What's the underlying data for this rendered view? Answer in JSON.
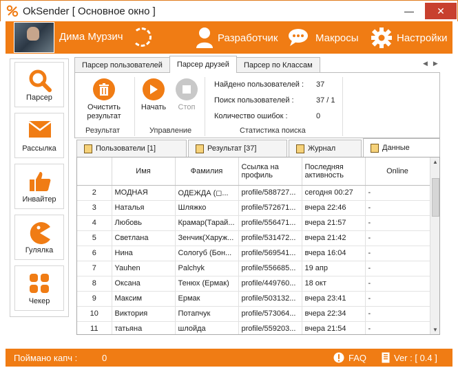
{
  "window": {
    "title": "OkSender [ Основное окно ]",
    "minimize": "—",
    "close": "✕"
  },
  "header": {
    "user_name": "Дима Мурзич",
    "developer_label": "Разработчик",
    "macros_label": "Макросы",
    "settings_label": "Настройки"
  },
  "sidebar": {
    "items": [
      {
        "label": "Парсер",
        "icon": "search-icon"
      },
      {
        "label": "Рассылка",
        "icon": "envelope-icon"
      },
      {
        "label": "Инвайтер",
        "icon": "thumbs-up-icon"
      },
      {
        "label": "Гулялка",
        "icon": "pacman-icon"
      },
      {
        "label": "Чекер",
        "icon": "grid-icon"
      }
    ]
  },
  "top_tabs": [
    "Парсер пользователей",
    "Парсер друзей",
    "Парсер по Классам"
  ],
  "toolbar": {
    "clear_label": "Очистить результат",
    "start_label": "Начать",
    "stop_label": "Стоп",
    "group_result": "Результат",
    "group_control": "Управление",
    "group_stats": "Статистика поиска",
    "stats": [
      {
        "label": "Найдено пользователей :",
        "value": "37"
      },
      {
        "label": "Поиск пользователей :",
        "value": "37 / 1"
      },
      {
        "label": "Количество ошибок :",
        "value": "0"
      }
    ]
  },
  "sub_tabs": [
    "Пользователи [1]",
    "Результат [37]",
    "Журнал",
    "Данные"
  ],
  "table": {
    "columns": [
      "",
      "Имя",
      "Фамилия",
      "Ссылка на профиль",
      "Последняя активность",
      "Online"
    ],
    "rows": [
      [
        "2",
        "МОДНАЯ",
        "ОДЕЖДА (◻...",
        "profile/588727...",
        "сегодня 00:27",
        "-"
      ],
      [
        "3",
        "Наталья",
        "Шляжко",
        "profile/572671...",
        "вчера 22:46",
        "-"
      ],
      [
        "4",
        "Любовь",
        "Крамар(Тарай...",
        "profile/556471...",
        "вчера 21:57",
        "-"
      ],
      [
        "5",
        "Светлана",
        "Зенчик(Харуж...",
        "profile/531472...",
        "вчера 21:42",
        "-"
      ],
      [
        "6",
        "Нина",
        "Сологуб (Бон...",
        "profile/569541...",
        "вчера 16:04",
        "-"
      ],
      [
        "7",
        "Yauhen",
        "Palchyk",
        "profile/556685...",
        "19 апр",
        "-"
      ],
      [
        "8",
        "Оксана",
        "Тенюх (Ермак)",
        "profile/449760...",
        "18 окт",
        "-"
      ],
      [
        "9",
        "Максим",
        "Ермак",
        "profile/503132...",
        "вчера 23:41",
        "-"
      ],
      [
        "10",
        "Виктория",
        "Потапчук",
        "profile/573064...",
        "вчера 22:34",
        "-"
      ],
      [
        "11",
        "татьяна",
        "шлойда",
        "profile/559203...",
        "вчера 21:54",
        "-"
      ]
    ]
  },
  "status": {
    "captcha_label": "Поймано капч :",
    "captcha_value": "0",
    "faq_label": "FAQ",
    "version_label": "Ver : [ 0.4 ]"
  },
  "colors": {
    "accent": "#f07c14",
    "close": "#c8402e"
  }
}
